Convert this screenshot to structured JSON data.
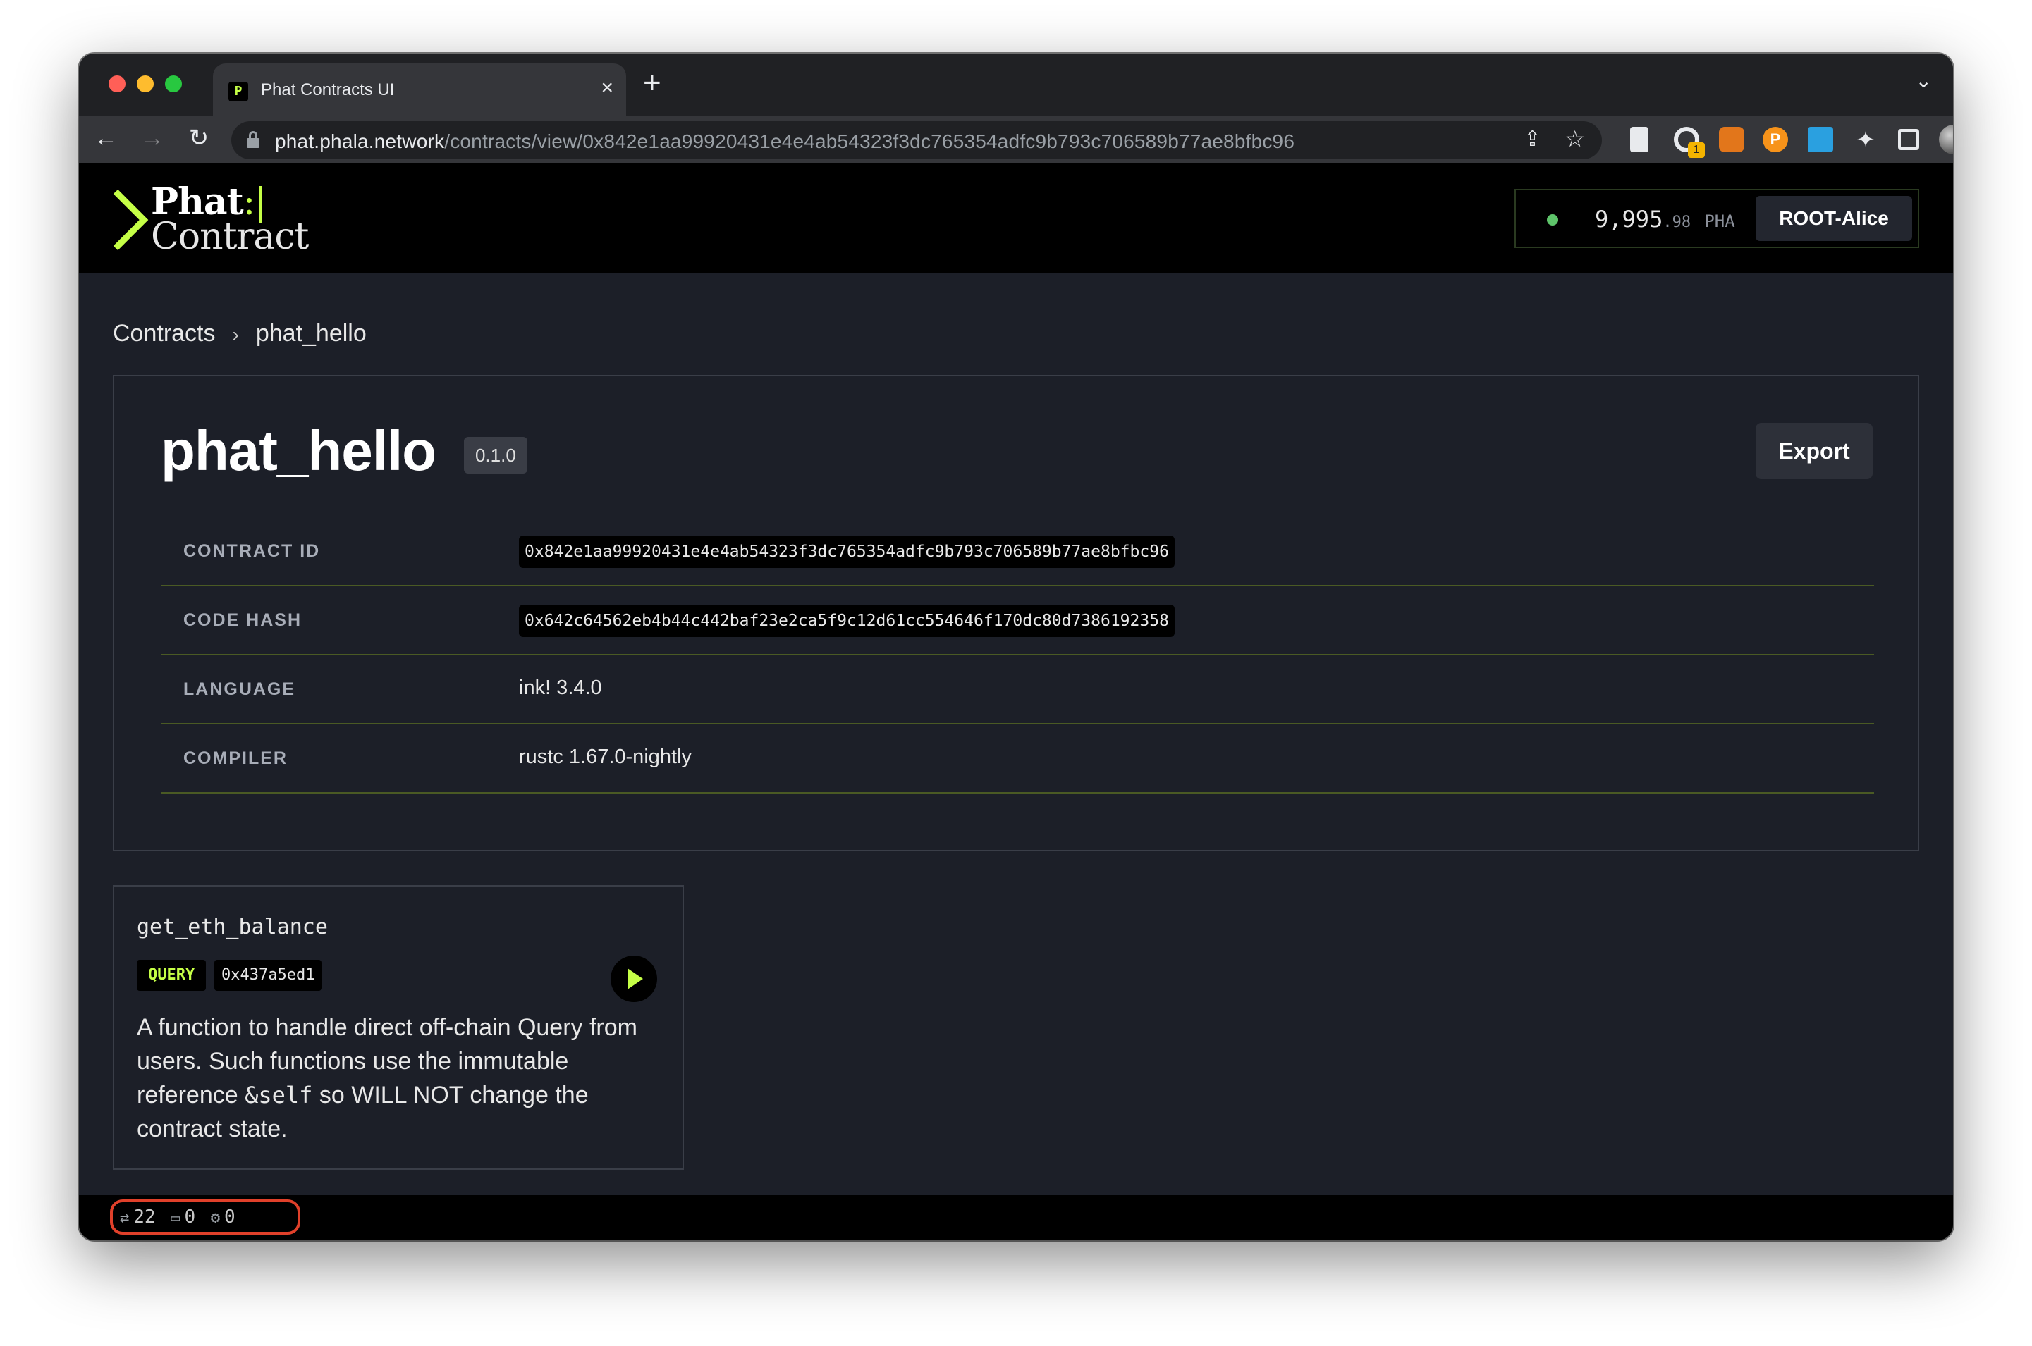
{
  "browser": {
    "tab_title": "Phat Contracts UI",
    "tab_favicon": "P",
    "tab_close": "×",
    "new_tab": "+",
    "url_host": "phat.phala.network",
    "url_path": "/contracts/view/0x842e1aa99920431e4e4ab54323f3dc765354adfc9b793c706589b77ae8bfbc96",
    "ext_badge": "1"
  },
  "header": {
    "logo_line1": "Phat",
    "logo_cursor": ":|",
    "logo_line2": "Contract",
    "balance_int": "9,995",
    "balance_dec": ".98",
    "balance_unit": "PHA",
    "account_name": "ROOT-Alice"
  },
  "breadcrumb": {
    "root": "Contracts",
    "separator": "›",
    "current": "phat_hello"
  },
  "contract": {
    "name": "phat_hello",
    "version": "0.1.0",
    "export_label": "Export",
    "meta": [
      {
        "label": "CONTRACT ID",
        "value": "0x842e1aa99920431e4e4ab54323f3dc765354adfc9b793c706589b77ae8bfbc96"
      },
      {
        "label": "CODE HASH",
        "value": "0x642c64562eb4b44c442baf23e2ca5f9c12d61cc554646f170dc80d7386192358"
      },
      {
        "label": "LANGUAGE",
        "value": "ink! 3.4.0"
      },
      {
        "label": "COMPILER",
        "value": "rustc 1.67.0-nightly"
      }
    ]
  },
  "method": {
    "name": "get_eth_balance",
    "type_tag": "QUERY",
    "selector": "0x437a5ed1",
    "desc_before": "A function to handle direct off-chain Query from users. Such functions use the immutable reference ",
    "desc_code": "&self",
    "desc_after": " so WILL NOT change the contract state."
  },
  "statusbar": {
    "connections": "22",
    "messages": "0",
    "events": "0"
  },
  "colors": {
    "accent": "#c5ff46",
    "background": "#1c1f28",
    "header_bg": "#000000",
    "highlight_ring": "#e0402a"
  }
}
